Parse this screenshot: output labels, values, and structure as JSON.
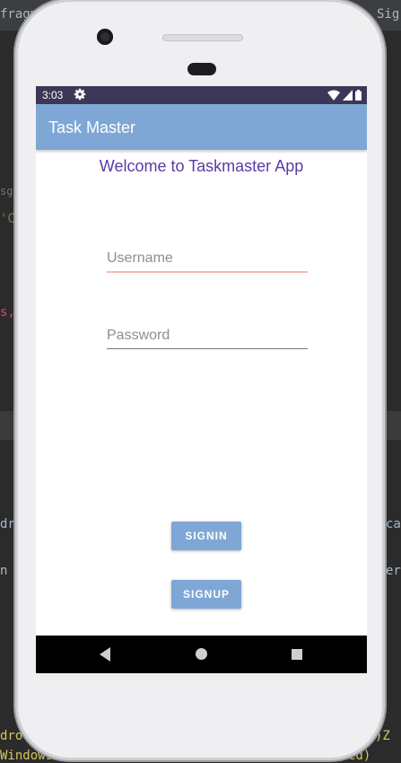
{
  "ide": {
    "tab_left": "fragm",
    "tab_right": "Sig",
    "code_fragments": [
      "sg:",
      "'Cr",
      "s,",
      "dr",
      "n t",
      "dro",
      "Windows",
      "cat",
      "er",
      ")Z",
      "ed)"
    ]
  },
  "statusbar": {
    "time": "3:03",
    "icons": [
      "settings-icon",
      "wifi-icon",
      "signal-icon",
      "battery-icon"
    ]
  },
  "appbar": {
    "title": "Task Master"
  },
  "main": {
    "welcome": "Welcome to Taskmaster App",
    "username_placeholder": "Username",
    "password_placeholder": "Password",
    "signin_label": "SIGNIN",
    "signup_label": "SIGNUP"
  },
  "navbar": {
    "icons": [
      "back-icon",
      "home-icon",
      "recents-icon"
    ]
  },
  "colors": {
    "appbar": "#7fa7d6",
    "statusbar": "#3e3656",
    "welcome_text": "#5b3aa4",
    "username_underline": "#f2b8b8"
  }
}
